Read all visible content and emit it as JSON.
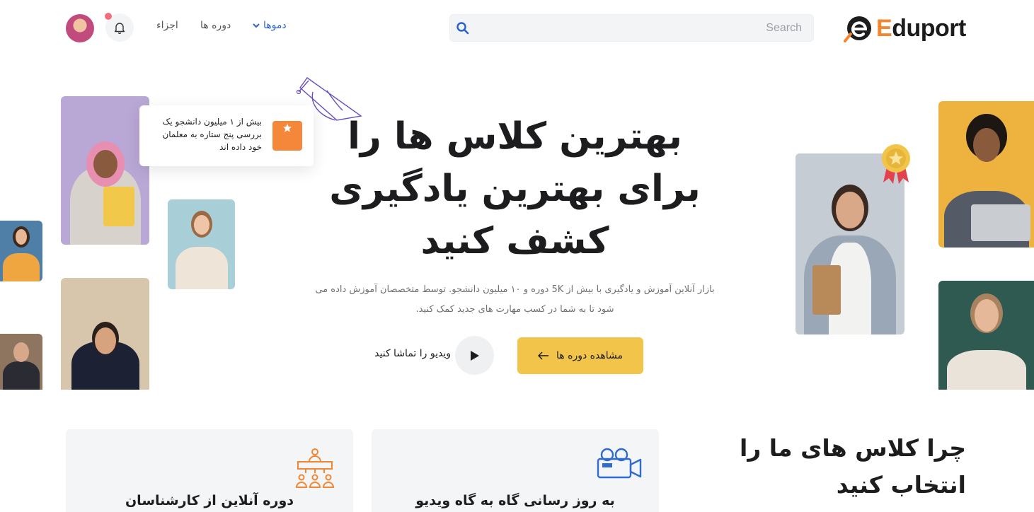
{
  "brand": {
    "name_first": "E",
    "name_rest": "duport",
    "accent": "#f58631"
  },
  "search": {
    "placeholder": "Search"
  },
  "nav": {
    "demos": "دموها",
    "courses": "دوره ها",
    "parts": "اجزاء"
  },
  "icons": {
    "search": "search-icon",
    "bell": "bell-icon",
    "chevron": "chevron-down-icon",
    "play": "play-icon",
    "arrow": "arrow-left-icon",
    "star": "star-icon",
    "grad_cap": "graduation-cap-icon",
    "medal": "medal-icon",
    "video_camera": "video-camera-icon",
    "classroom": "classroom-icon"
  },
  "review": {
    "text": "بیش از ۱ میلیون دانشجو یک بررسی پنج ستاره به معلمان خود داده اند"
  },
  "hero": {
    "title": "بهترین کلاس ها را برای بهترین یادگیری کشف کنید",
    "description": "بازار آنلاین آموزش و یادگیری با بیش از 5K دوره و ۱۰ میلیون دانشجو. توسط متخصصان آموزش داده می شود تا به شما در کسب مهارت های جدید کمک کنید.",
    "cta_label": "مشاهده دوره ها",
    "watch_label": "ویدیو را تماشا کنید"
  },
  "why": {
    "title": "چرا کلاس های ما را انتخاب کنید",
    "cards": [
      {
        "title": "به روز رسانی گاه به گاه ویدیو"
      },
      {
        "title": "دوره آنلاین از کارشناسان"
      }
    ]
  },
  "colors": {
    "primary_button": "#f3c44a",
    "link": "#2a62c9",
    "notification": "#ef6f7d",
    "badge": "#f5873a"
  }
}
